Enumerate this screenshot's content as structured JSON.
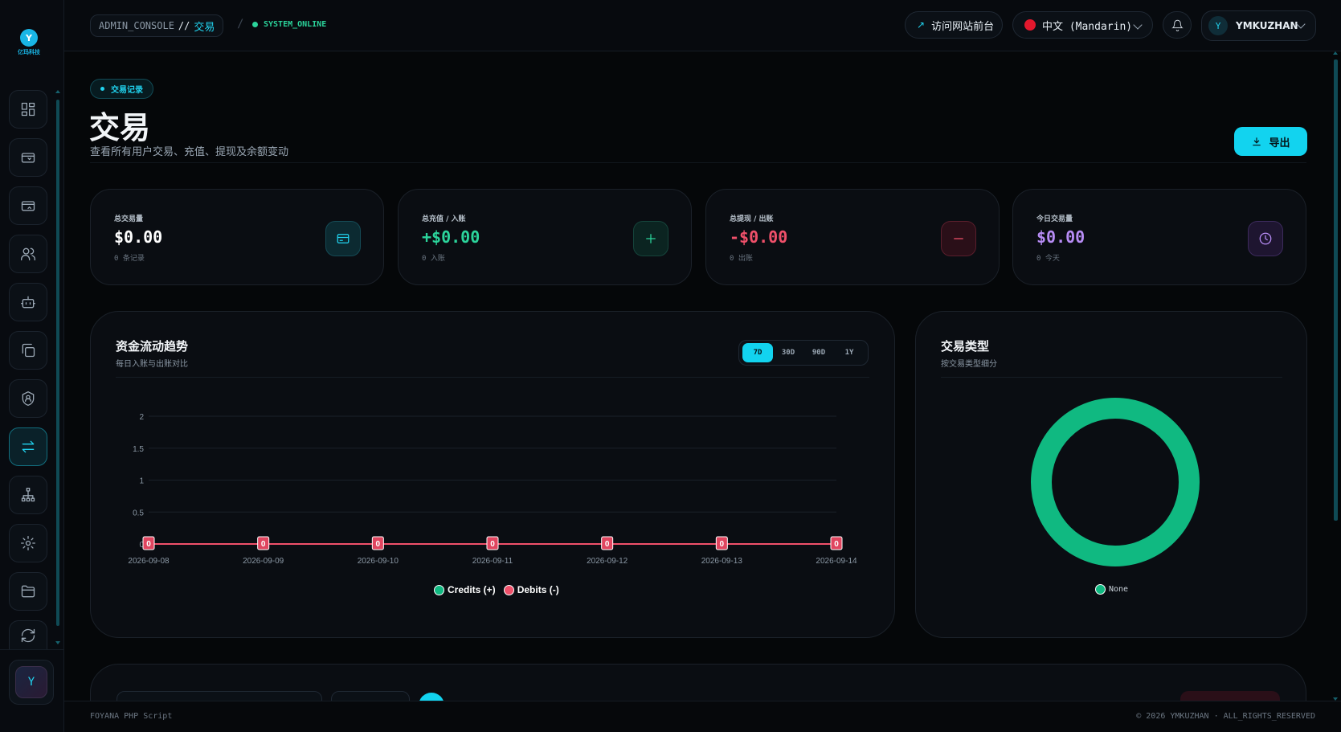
{
  "header": {
    "crumb_root": "ADMIN_CONSOLE",
    "crumb_sep": "//",
    "crumb_current": "交易",
    "divider": "/",
    "status": "SYSTEM_ONLINE",
    "visit_label": "访问网站前台",
    "language": "中文 (Mandarin)",
    "user_initial": "Y",
    "username": "YMKUZHAN"
  },
  "sidebar": {
    "logo_mark": "Y",
    "logo_text": "亿玛科技",
    "items": [
      {
        "icon": "dashboard-icon"
      },
      {
        "icon": "wallet-in-icon"
      },
      {
        "icon": "wallet-out-icon"
      },
      {
        "icon": "users-icon"
      },
      {
        "icon": "bot-icon"
      },
      {
        "icon": "copy-icon"
      },
      {
        "icon": "shield-user-icon"
      },
      {
        "icon": "transfer-icon",
        "active": true
      },
      {
        "icon": "network-icon"
      },
      {
        "icon": "settings-icon"
      },
      {
        "icon": "folder-icon"
      },
      {
        "icon": "refresh-icon"
      }
    ],
    "avatar_initial": "Y"
  },
  "page": {
    "tag": "交易记录",
    "title": "交易",
    "subtitle": "查看所有用户交易、充值、提现及余额变动",
    "export_label": "导出"
  },
  "stats": [
    {
      "label": "总交易量",
      "value": "$0.00",
      "sub": "0 条记录",
      "color": "#ffffff",
      "icon": "card-icon"
    },
    {
      "label": "总充值 / 入账",
      "value": "+$0.00",
      "sub": "0 入账",
      "color": "#2bd49b",
      "icon": "plus-icon"
    },
    {
      "label": "总提现 / 出账",
      "value": "-$0.00",
      "sub": "0 出账",
      "color": "#f0506a",
      "icon": "minus-icon"
    },
    {
      "label": "今日交易量",
      "value": "$0.00",
      "sub": "0 今天",
      "color": "#b78cf5",
      "icon": "clock-icon"
    }
  ],
  "trend_panel": {
    "title": "资金流动趋势",
    "subtitle": "每日入账与出账对比",
    "ranges": [
      "7D",
      "30D",
      "90D",
      "1Y"
    ],
    "active_range": "7D"
  },
  "type_panel": {
    "title": "交易类型",
    "subtitle": "按交易类型细分"
  },
  "chart_data": [
    {
      "type": "line",
      "x": [
        "2026-09-08",
        "2026-09-09",
        "2026-09-10",
        "2026-09-11",
        "2026-09-12",
        "2026-09-13",
        "2026-09-14"
      ],
      "series": [
        {
          "name": "Credits (+)",
          "values": [
            0,
            0,
            0,
            0,
            0,
            0,
            0
          ],
          "color": "#10b981"
        },
        {
          "name": "Debits (-)",
          "values": [
            0,
            0,
            0,
            0,
            0,
            0,
            0
          ],
          "color": "#f0506a"
        }
      ],
      "yticks": [
        "0",
        "0.5",
        "1",
        "1.5",
        "2"
      ],
      "ylim": [
        0,
        2
      ],
      "grid": true,
      "legend": "bottom-center"
    },
    {
      "type": "pie",
      "categories": [
        "None"
      ],
      "values": [
        1
      ],
      "colors": [
        "#10b981"
      ],
      "legend": "bottom-center"
    }
  ],
  "footer": {
    "left": "FOYANA PHP Script",
    "right": "© 2026 YMKUZHAN · ALL_RIGHTS_RESERVED"
  }
}
